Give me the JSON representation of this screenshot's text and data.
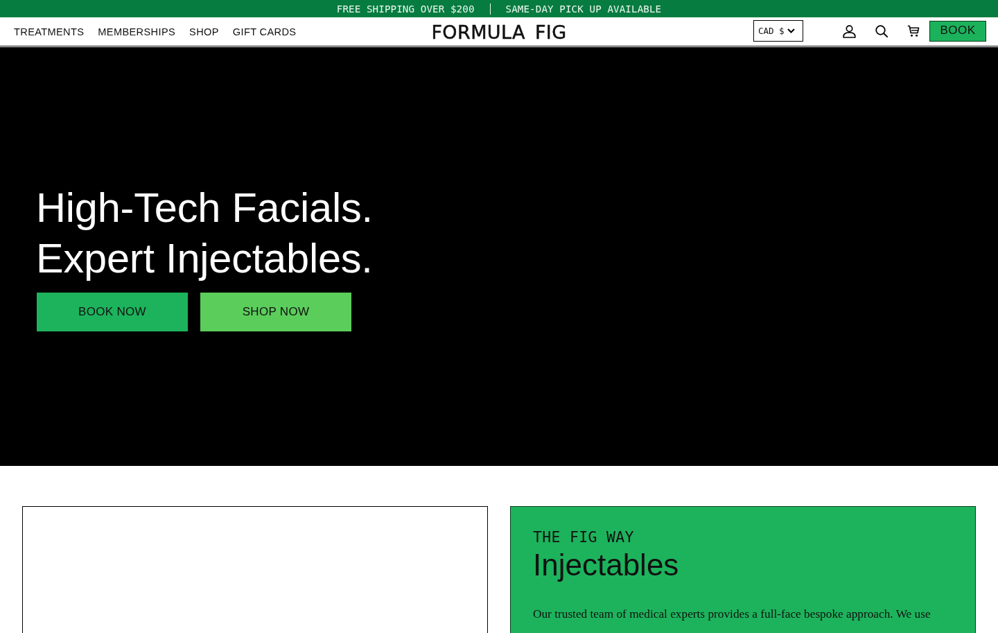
{
  "announcement_bar": {
    "messages": [
      "FREE SHIPPING OVER $200",
      "SAME-DAY PICK UP AVAILABLE"
    ]
  },
  "header": {
    "nav_links": [
      "TREATMENTS",
      "MEMBERSHIPS",
      "SHOP",
      "GIFT CARDS"
    ],
    "logo": "FORMULA FIG",
    "currency": "CAD $",
    "book_button": "BOOK"
  },
  "hero": {
    "heading_lines": [
      "High-Tech Facials.",
      "Expert Injectables."
    ],
    "buttons": [
      {
        "label": "BOOK NOW",
        "kind": "primary"
      },
      {
        "label": "SHOP NOW",
        "kind": "secondary"
      }
    ]
  },
  "feature": {
    "eyebrow": "THE FIG WAY",
    "title": "Injectables",
    "body": "Our trusted team of medical experts provides a full-face bespoke approach. We use"
  }
}
